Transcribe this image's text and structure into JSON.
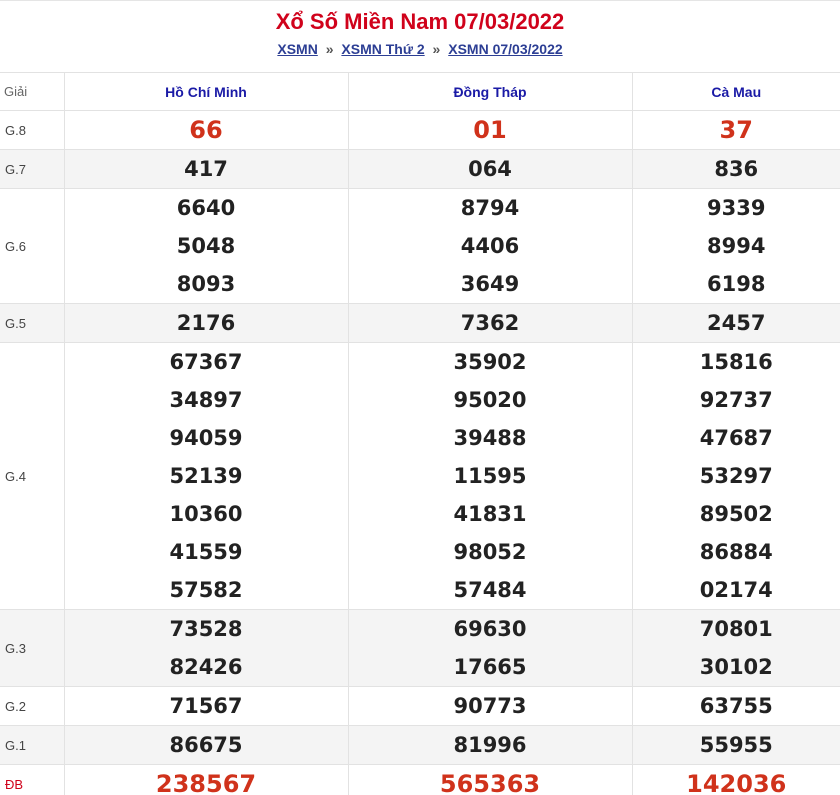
{
  "header": {
    "title": "Xổ Số Miền Nam 07/03/2022",
    "breadcrumb": [
      {
        "label": "XSMN"
      },
      {
        "label": "XSMN Thứ 2"
      },
      {
        "label": "XSMN 07/03/2022"
      }
    ],
    "separator": "»"
  },
  "table": {
    "giai_header": "Giải",
    "provinces": [
      "Hồ Chí Minh",
      "Đồng Tháp",
      "Cà Mau"
    ],
    "prizes": [
      {
        "label": "G.8",
        "red": true,
        "values": [
          [
            "66"
          ],
          [
            "01"
          ],
          [
            "37"
          ]
        ]
      },
      {
        "label": "G.7",
        "values": [
          [
            "417"
          ],
          [
            "064"
          ],
          [
            "836"
          ]
        ]
      },
      {
        "label": "G.6",
        "values": [
          [
            "6640",
            "5048",
            "8093"
          ],
          [
            "8794",
            "4406",
            "3649"
          ],
          [
            "9339",
            "8994",
            "6198"
          ]
        ]
      },
      {
        "label": "G.5",
        "values": [
          [
            "2176"
          ],
          [
            "7362"
          ],
          [
            "2457"
          ]
        ]
      },
      {
        "label": "G.4",
        "values": [
          [
            "67367",
            "34897",
            "94059",
            "52139",
            "10360",
            "41559",
            "57582"
          ],
          [
            "35902",
            "95020",
            "39488",
            "11595",
            "41831",
            "98052",
            "57484"
          ],
          [
            "15816",
            "92737",
            "47687",
            "53297",
            "89502",
            "86884",
            "02174"
          ]
        ]
      },
      {
        "label": "G.3",
        "values": [
          [
            "73528",
            "82426"
          ],
          [
            "69630",
            "17665"
          ],
          [
            "70801",
            "30102"
          ]
        ]
      },
      {
        "label": "G.2",
        "values": [
          [
            "71567"
          ],
          [
            "90773"
          ],
          [
            "63755"
          ]
        ]
      },
      {
        "label": "G.1",
        "values": [
          [
            "86675"
          ],
          [
            "81996"
          ],
          [
            "55955"
          ]
        ]
      },
      {
        "label": "ĐB",
        "red": true,
        "special": true,
        "values": [
          [
            "238567"
          ],
          [
            "565363"
          ],
          [
            "142036"
          ]
        ]
      }
    ]
  }
}
